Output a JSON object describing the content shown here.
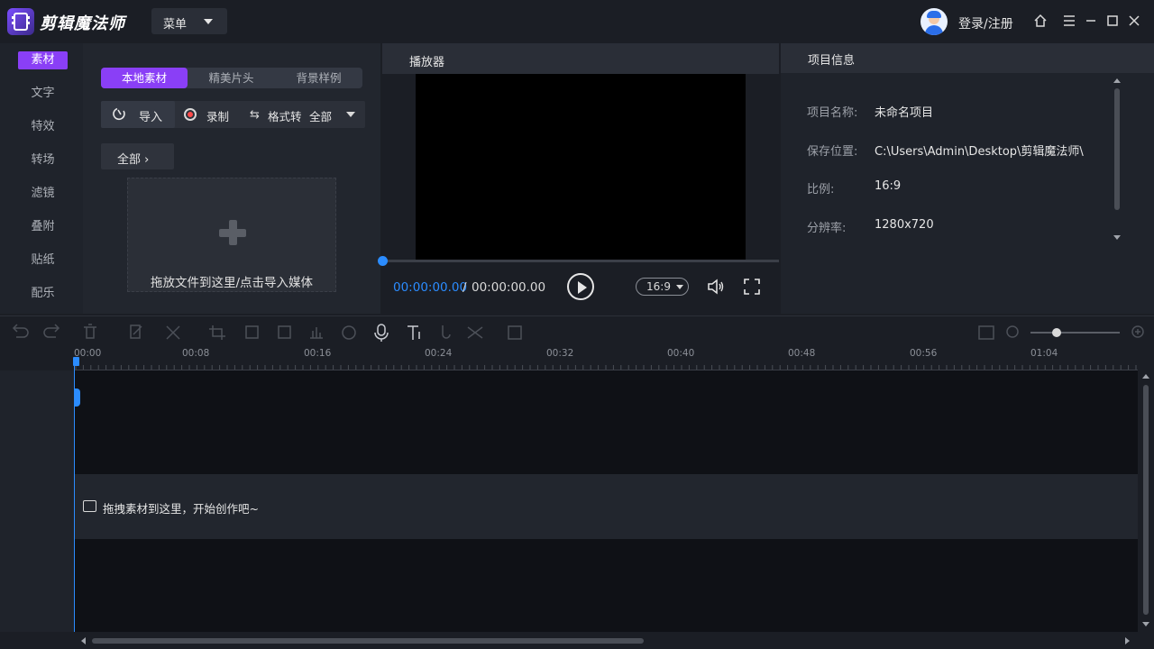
{
  "app": {
    "title": "剪辑魔法师",
    "menu_label": "菜单",
    "login_label": "登录/注册"
  },
  "categories": [
    "素材",
    "文字",
    "特效",
    "转场",
    "滤镜",
    "叠附",
    "贴纸",
    "配乐"
  ],
  "media": {
    "tabs": [
      "本地素材",
      "精美片头",
      "背景样例"
    ],
    "import_label": "导入",
    "record_label": "录制",
    "format_label": "格式转",
    "format_value": "全部",
    "filter_label": "全部 ›",
    "drop_hint": "拖放文件到这里/点击导入媒体"
  },
  "player": {
    "title": "播放器",
    "current_time": "00:00:00.00",
    "separator": "/",
    "total_time": "00:00:00.00",
    "ratio": "16:9",
    "progress": 0
  },
  "project": {
    "title": "项目信息",
    "rows": [
      {
        "key": "项目名称:",
        "value": "未命名项目"
      },
      {
        "key": "保存位置:",
        "value": "C:\\Users\\Admin\\Desktop\\剪辑魔法师\\"
      },
      {
        "key": "比例:",
        "value": "16:9"
      },
      {
        "key": "分辨率:",
        "value": "1280x720"
      }
    ]
  },
  "timeline": {
    "ticks": [
      "00:00",
      "00:08",
      "00:16",
      "00:24",
      "00:32",
      "00:40",
      "00:48",
      "00:56",
      "01:04"
    ],
    "track_hint": "拖拽素材到这里，开始创作吧~"
  },
  "colors": {
    "accent": "#8a3ff6",
    "playhead": "#2b8cff"
  }
}
